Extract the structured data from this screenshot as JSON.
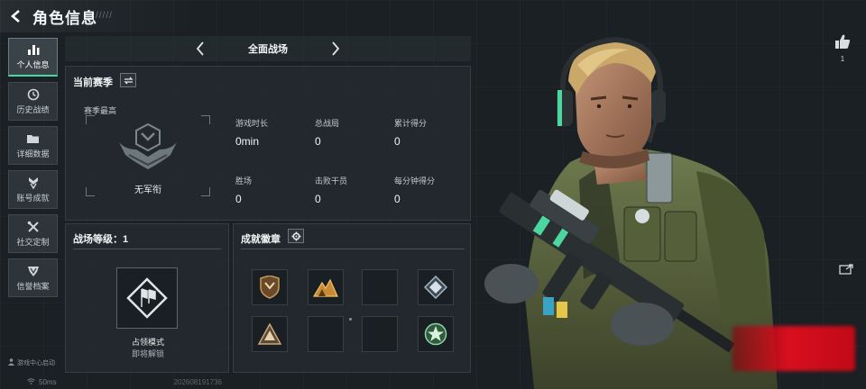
{
  "header": {
    "title": "角色信息",
    "menu_glyph": "/////"
  },
  "sidebar": {
    "items": [
      {
        "label": "个人信息",
        "icon": "bar-chart-icon",
        "active": true
      },
      {
        "label": "历史战绩",
        "icon": "history-icon",
        "active": false
      },
      {
        "label": "详细数据",
        "icon": "folder-icon",
        "active": false
      },
      {
        "label": "账号成就",
        "icon": "medal-icon",
        "active": false
      },
      {
        "label": "社交定制",
        "icon": "tools-icon",
        "active": false
      },
      {
        "label": "信誉档案",
        "icon": "shield-icon",
        "active": false
      }
    ],
    "footer": "游戏中心启动"
  },
  "status": {
    "ping": "50ms",
    "uid": "202608191736"
  },
  "mode_bar": {
    "title": "全面战场"
  },
  "season": {
    "title": "当前赛季",
    "best_label": "赛季最高",
    "rank_name": "无军衔",
    "stats": [
      {
        "label": "游戏时长",
        "value": "0min"
      },
      {
        "label": "总战局",
        "value": "0"
      },
      {
        "label": "累计得分",
        "value": "0"
      },
      {
        "label": "胜场",
        "value": "0"
      },
      {
        "label": "击败干员",
        "value": "0"
      },
      {
        "label": "每分钟得分",
        "value": "0"
      }
    ]
  },
  "level": {
    "title": "战场等级：1",
    "mode_name": "占领模式",
    "mode_status": "即将解锁"
  },
  "badges": {
    "title": "成就徽章",
    "items": [
      {
        "icon": "shield-crest-badge-icon",
        "filled": true
      },
      {
        "icon": "mountain-badge-icon",
        "filled": true
      },
      {
        "icon": "empty-badge-slot",
        "filled": false
      },
      {
        "icon": "diamond-badge-icon",
        "filled": true
      },
      {
        "icon": "triangle-badge-icon",
        "filled": true
      },
      {
        "icon": "empty-badge-slot",
        "filled": false
      },
      {
        "icon": "empty-badge-slot",
        "filled": false
      },
      {
        "icon": "star-round-badge-icon",
        "filled": true
      }
    ]
  },
  "likes": {
    "count": "1"
  },
  "colors": {
    "accent": "#4cd6a0",
    "panel": "#242b2f",
    "red_button": "#d80f1e"
  }
}
